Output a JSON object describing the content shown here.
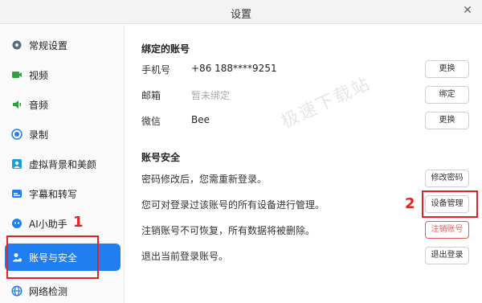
{
  "window": {
    "title": "设置",
    "close_icon": "close-icon"
  },
  "sidebar": {
    "items": [
      {
        "label": "常规设置",
        "icon": "gear-icon",
        "color": "#5a6b7d"
      },
      {
        "label": "视频",
        "icon": "video-camera-icon",
        "color": "#2ea043"
      },
      {
        "label": "音频",
        "icon": "speaker-icon",
        "color": "#2ea043"
      },
      {
        "label": "录制",
        "icon": "record-icon",
        "color": "#1f7ef0"
      },
      {
        "label": "虚拟背景和美颜",
        "icon": "portrait-icon",
        "color": "#1aa0d8"
      },
      {
        "label": "字幕和转写",
        "icon": "caption-icon",
        "color": "#1f7ef0"
      },
      {
        "label": "AI小助手",
        "icon": "ai-assistant-icon",
        "color": "#1f7ef0"
      },
      {
        "label": "账号与安全",
        "icon": "account-security-icon",
        "color": "#ffffff"
      },
      {
        "label": "网络检测",
        "icon": "globe-icon",
        "color": "#1f7ef0"
      }
    ],
    "active_index": 7
  },
  "bound": {
    "title": "绑定的账号",
    "rows": [
      {
        "label": "手机号",
        "value": "+86 188****9251",
        "button": "更换"
      },
      {
        "label": "邮箱",
        "value": "暂未绑定",
        "button": "绑定"
      },
      {
        "label": "微信",
        "value": "Bee",
        "button": "更换"
      }
    ]
  },
  "security": {
    "title": "账号安全",
    "rows": [
      {
        "text": "密码修改后，您需重新登录。",
        "button": "修改密码"
      },
      {
        "text": "您可对登录过该账号的所有设备进行管理。",
        "button": "设备管理"
      },
      {
        "text": "注销账号不可恢复，所有数据将被删除。",
        "button": "注销账号"
      },
      {
        "text": "退出当前登录账号。",
        "button": "退出登录"
      }
    ]
  },
  "annotations": {
    "marker_1": "1",
    "marker_2": "2"
  },
  "watermark": "极速下载站",
  "colors": {
    "accent": "#1f7ef0",
    "danger": "#e35b5b",
    "annotation": "#e02424"
  }
}
